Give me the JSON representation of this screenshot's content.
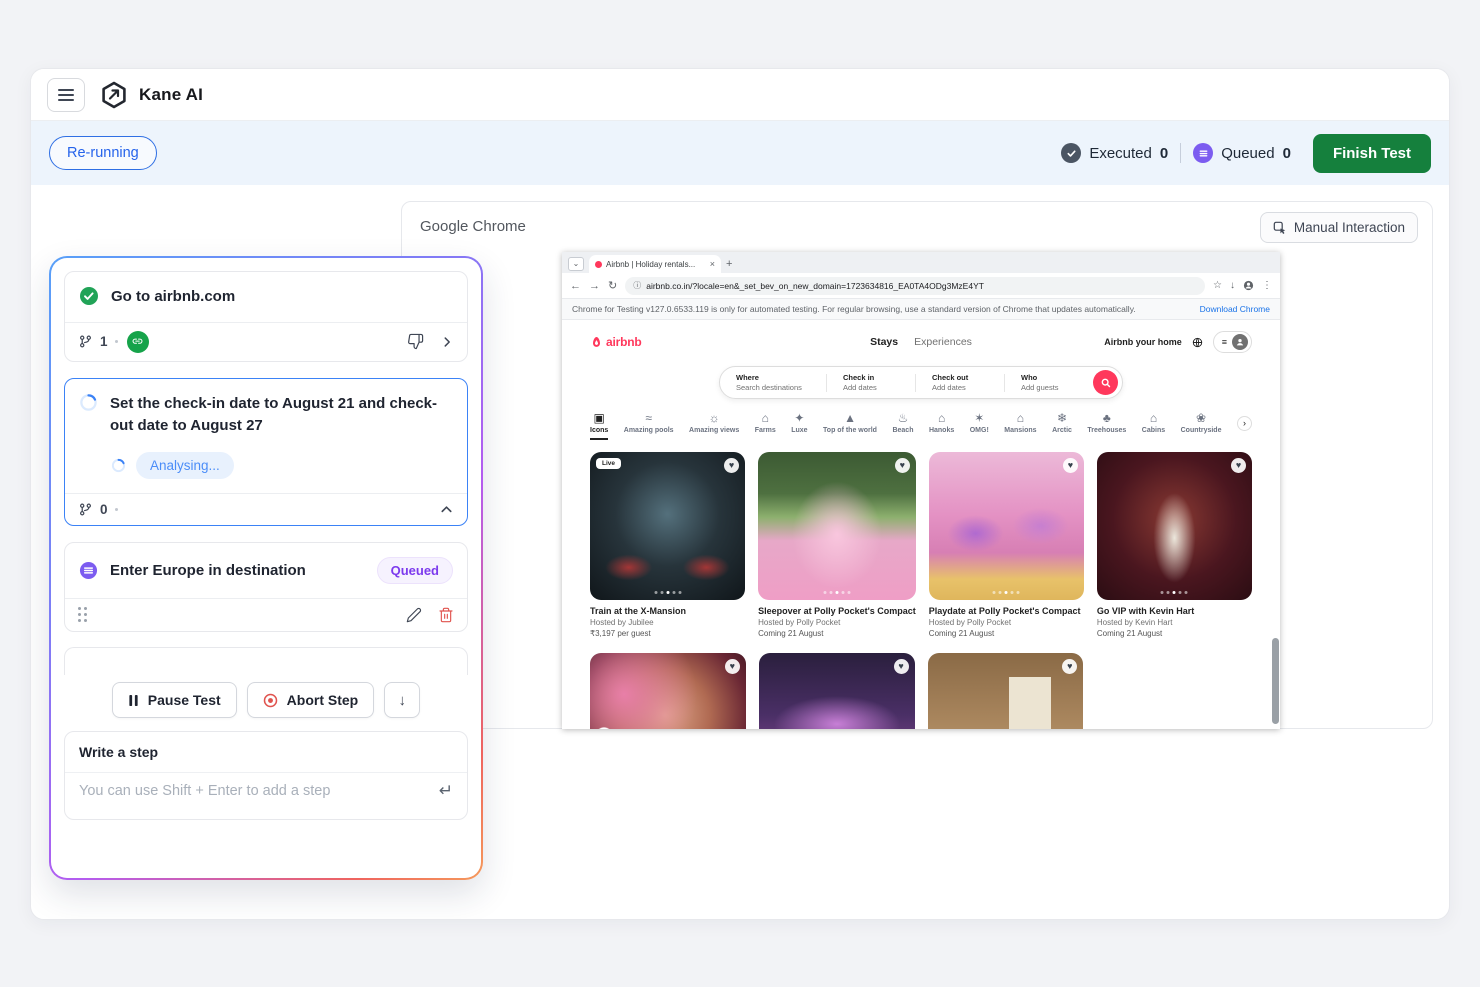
{
  "header": {
    "title": "Kane AI"
  },
  "statusbar": {
    "run_status": "Re-running",
    "executed_label": "Executed",
    "executed_count": "0",
    "queued_label": "Queued",
    "queued_count": "0",
    "finish_button": "Finish Test"
  },
  "steps": {
    "step1": {
      "text": "Go to airbnb.com",
      "branch_count": "1"
    },
    "step2": {
      "text": "Set the check-in date to August 21 and check-out date to August 27",
      "status": "Analysing...",
      "branch_count": "0"
    },
    "step3": {
      "text": "Enter Europe in destination",
      "badge": "Queued"
    },
    "controls": {
      "pause": "Pause Test",
      "abort": "Abort Step"
    },
    "composer": {
      "label": "Write a step",
      "placeholder": "You can use Shift + Enter to add a step"
    }
  },
  "browser": {
    "panel_title": "Google Chrome",
    "manual_interaction": "Manual Interaction",
    "tab_title": "Airbnb | Holiday rentals...",
    "url": "airbnb.co.in/?locale=en&_set_bev_on_new_domain=1723634816_EA0TA4ODg3MzE4YT",
    "notice": "Chrome for Testing v127.0.6533.119 is only for automated testing. For regular browsing, use a standard version of Chrome that updates automatically.",
    "notice_link": "Download Chrome"
  },
  "airbnb": {
    "logo_text": "airbnb",
    "nav_stays": "Stays",
    "nav_experiences": "Experiences",
    "host_link": "Airbnb your home",
    "search_sections": [
      {
        "label": "Where",
        "value": "Search destinations"
      },
      {
        "label": "Check in",
        "value": "Add dates"
      },
      {
        "label": "Check out",
        "value": "Add dates"
      },
      {
        "label": "Who",
        "value": "Add guests"
      }
    ],
    "categories": [
      "Icons",
      "Amazing pools",
      "Amazing views",
      "Farms",
      "Luxe",
      "Top of the world",
      "Beach",
      "Hanoks",
      "OMG!",
      "Mansions",
      "Arctic",
      "Treehouses",
      "Cabins",
      "Countryside"
    ],
    "cards": [
      {
        "title": "Train at the X-Mansion",
        "host": "Hosted by Jubilee",
        "meta": "₹3,197 per guest",
        "badge": "Live"
      },
      {
        "title": "Sleepover at Polly Pocket's Compact",
        "host": "Hosted by Polly Pocket",
        "meta": "Coming 21 August"
      },
      {
        "title": "Playdate at Polly Pocket's Compact",
        "host": "Hosted by Polly Pocket",
        "meta": "Coming 21 August"
      },
      {
        "title": "Go VIP with Kevin Hart",
        "host": "Hosted by Kevin Hart",
        "meta": "Coming 21 August"
      }
    ]
  },
  "icons_text": {
    "tab_chevron": "⌄",
    "close": "×",
    "plus": "+",
    "back": "←",
    "forward": "→",
    "reload": "↻",
    "badge": "ⓘ",
    "star": "☆",
    "download": "↓",
    "more": "⋮",
    "menu": "≡",
    "chevron_right_small": "›",
    "down_arrow": "↓",
    "return": "↵",
    "heart": "♥",
    "category_glyphs": [
      "▣",
      "≈",
      "☼",
      "⌂",
      "✦",
      "▲",
      "♨",
      "⌂",
      "✶",
      "⌂",
      "❄",
      "♣",
      "⌂",
      "❀"
    ]
  }
}
